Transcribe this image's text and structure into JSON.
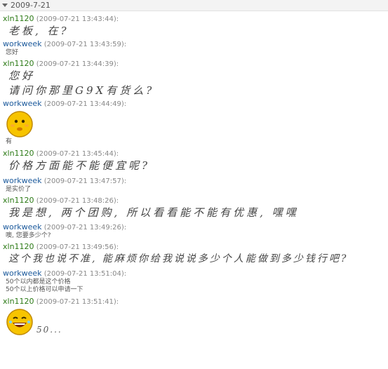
{
  "date": "2009-7-21",
  "messages": [
    {
      "user": "xln1120",
      "time": "(2009-07-21 13:43:44):",
      "text": "老板, 在?"
    },
    {
      "user": "workweek",
      "time": "(2009-07-21 13:43:59):",
      "text": "您好"
    },
    {
      "user": "xln1120",
      "time": "(2009-07-21 13:44:39):",
      "line1": "您好",
      "line2": "请问你那里G9X有货么?"
    },
    {
      "user": "workweek",
      "time": "(2009-07-21 13:44:49):",
      "text": "有",
      "emoticon": "smiley-face-icon"
    },
    {
      "user": "xln1120",
      "time": "(2009-07-21 13:45:44):",
      "text": "价格方面能不能便宜呢?"
    },
    {
      "user": "workweek",
      "time": "(2009-07-21 13:47:57):",
      "text": "是实价了"
    },
    {
      "user": "xln1120",
      "time": "(2009-07-21 13:48:26):",
      "text": "我是想, 两个团购, 所以看看能不能有优惠, 嘿嘿"
    },
    {
      "user": "workweek",
      "time": "(2009-07-21 13:49:26):",
      "text": "噢, 您要多少个?"
    },
    {
      "user": "xln1120",
      "time": "(2009-07-21 13:49:56):",
      "text": "这个我也说不准, 能麻烦你给我说说多少个人能做到多少钱行吧?"
    },
    {
      "user": "workweek",
      "time": "(2009-07-21 13:51:04):",
      "line1": "50个以内都是这个价格",
      "line2": "50个以上价格可以申请一下"
    },
    {
      "user": "xln1120",
      "time": "(2009-07-21 13:51:41):",
      "text": "50...",
      "emoticon": "laughing-face-icon"
    }
  ],
  "colors": {
    "user_green": "#2c7a16",
    "user_blue": "#1c5a9c"
  }
}
